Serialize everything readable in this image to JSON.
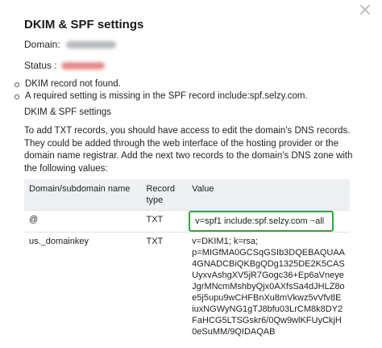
{
  "icons": {
    "close": "close-icon"
  },
  "colors": {
    "highlight_border": "#2ea63f",
    "table_header_bg": "#eef0f3"
  },
  "dialog": {
    "title": "DKIM & SPF settings",
    "domain_label": "Domain:",
    "status_label": "Status :",
    "messages": [
      "DKIM record not found.",
      "A required setting is missing in the SPF record include:spf.selzy.com."
    ],
    "subheading": "DKIM & SPF settings",
    "instructions": "To add TXT records, you should have access to edit the domain's DNS records. They could be added through the web interface of the hosting provider or the domain name registrar. Add the next two records to the domain's DNS zone with the following values:"
  },
  "table": {
    "headers": {
      "domain": "Domain/subdomain name",
      "type": "Record type",
      "value": "Value"
    },
    "rows": [
      {
        "domain": "@",
        "type": "TXT",
        "value": "v=spf1 include:spf.selzy.com ~all"
      },
      {
        "domain": "us._domainkey",
        "type": "TXT",
        "value_lines": [
          "v=DKIM1; k=rsa;",
          "p=MIGfMA0GCSqGSIb3DQEBAQUAA",
          "4GNADCBiQKBgQDg1325DE2K5CAS",
          "UyxvAshgXV5jR7Gogc36+Ep6aVneye",
          "JgrMNcmMshbyQjx0AXfsSa4dJHLZ8o",
          "e5j5upu9wCHFBnXu8mVkwz5vVfv8E",
          "iuxNGWyNG1gTJ8bfu03LrCM8k8DY2",
          "FaHCG5LTSGskr6/0Qw9wlKFUyCkjH",
          "0eSuMM/9QIDAQAB"
        ]
      }
    ]
  }
}
